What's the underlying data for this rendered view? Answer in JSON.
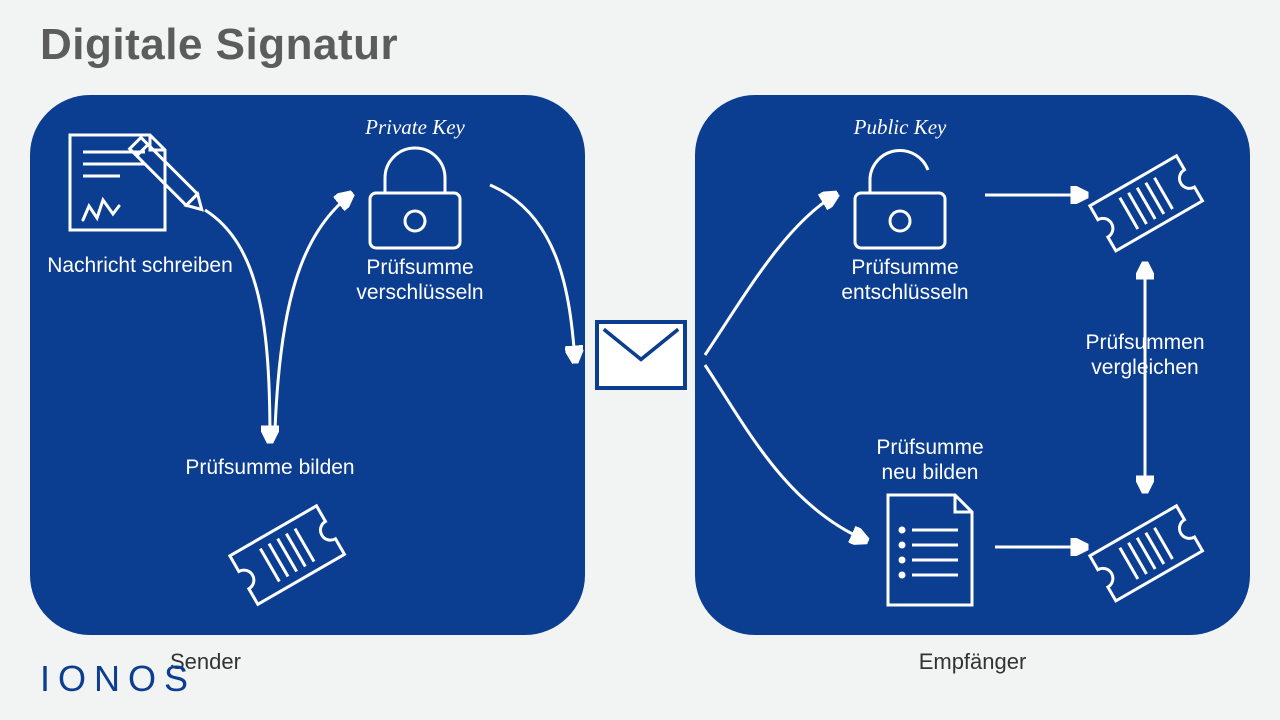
{
  "title": "Digitale Signatur",
  "logo": "IONOS",
  "envelope_name": "mail-icon",
  "sender": {
    "caption": "Sender",
    "private_key": "Private Key",
    "write_message": "Nachricht schreiben",
    "encrypt_checksum_line1": "Prüfsumme",
    "encrypt_checksum_line2": "verschlüsseln",
    "build_checksum": "Prüfsumme bilden"
  },
  "receiver": {
    "caption": "Empfänger",
    "public_key": "Public Key",
    "decrypt_checksum_line1": "Prüfsumme",
    "decrypt_checksum_line2": "entschlüsseln",
    "build_checksum_line1": "Prüfsumme",
    "build_checksum_line2": "neu bilden",
    "compare_line1": "Prüfsummen",
    "compare_line2": "vergleichen"
  }
}
